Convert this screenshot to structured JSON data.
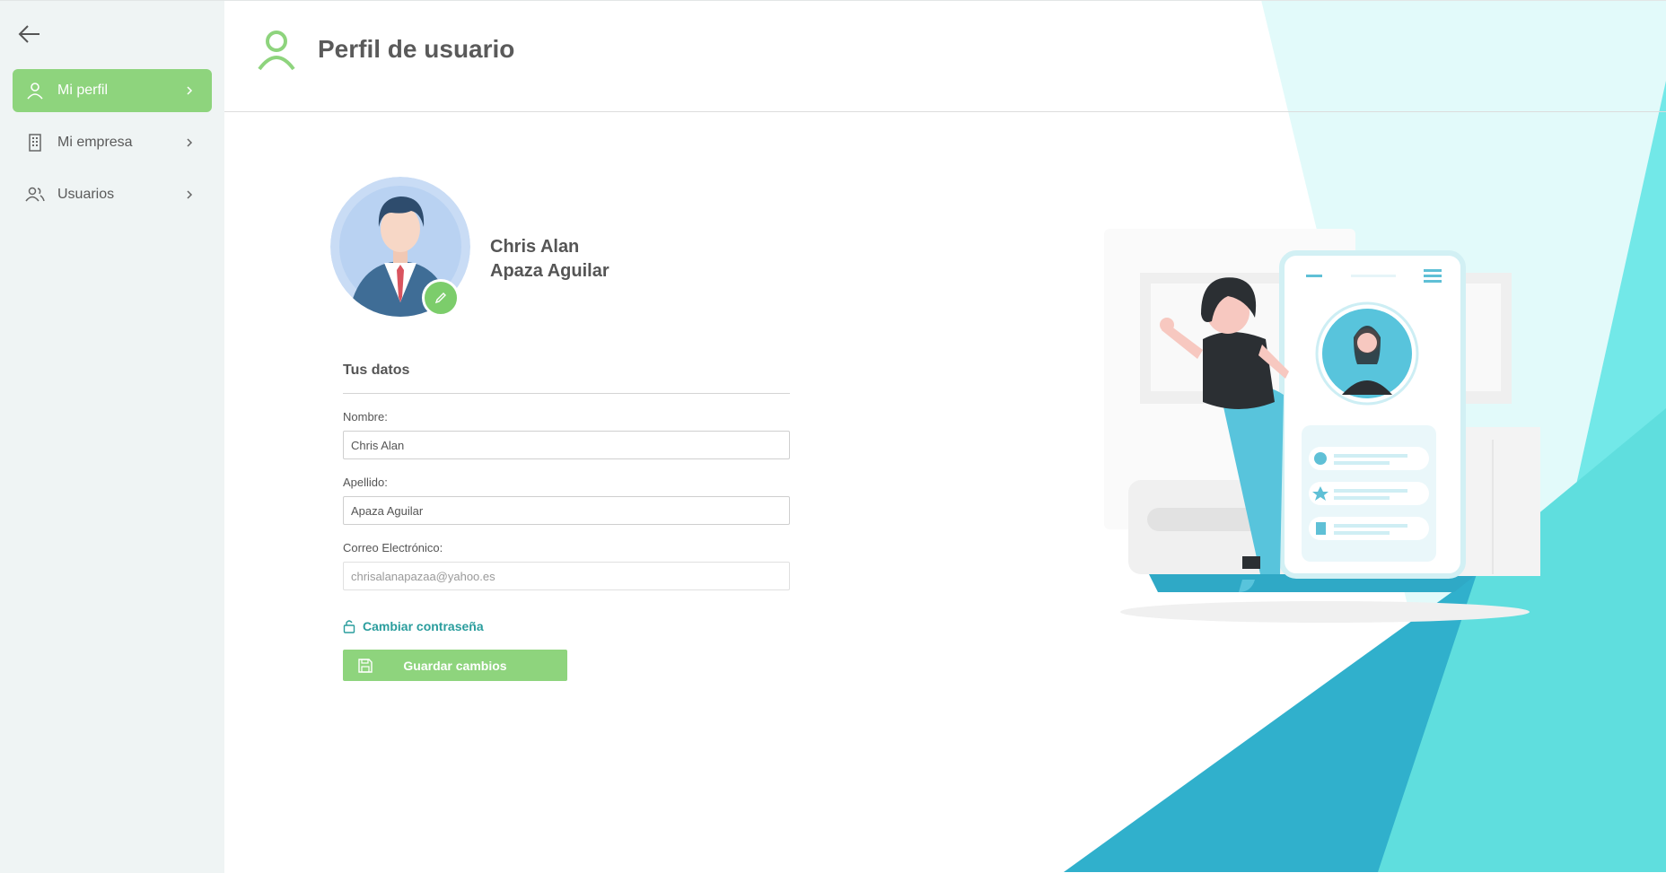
{
  "sidebar": {
    "items": [
      {
        "label": "Mi perfil",
        "icon": "user-icon",
        "active": true
      },
      {
        "label": "Mi empresa",
        "icon": "building-icon",
        "active": false
      },
      {
        "label": "Usuarios",
        "icon": "users-icon",
        "active": false
      }
    ]
  },
  "header": {
    "title": "Perfil de usuario",
    "icon": "user-icon"
  },
  "profile": {
    "first_name": "Chris Alan",
    "last_name": "Apaza Aguilar"
  },
  "form": {
    "section_title": "Tus datos",
    "fields": [
      {
        "label": "Nombre:",
        "value": "Chris Alan"
      },
      {
        "label": "Apellido:",
        "value": "Apaza Aguilar"
      },
      {
        "label": "Correo Electrónico:",
        "value": "chrisalanapazaa@yahoo.es"
      }
    ],
    "change_password": "Cambiar contraseña",
    "save": "Guardar cambios"
  },
  "colors": {
    "accent": "#8ed47d",
    "link": "#2a9d9d",
    "sidebar_bg": "#eff4f4",
    "teal": "#35b3cc"
  }
}
